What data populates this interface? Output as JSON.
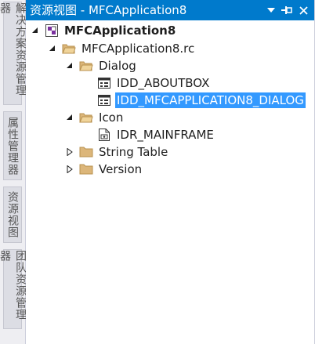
{
  "side_tabs": [
    {
      "label": "解决方案资源管理器"
    },
    {
      "label": "属性管理器"
    },
    {
      "label": "资源视图"
    },
    {
      "label": "团队资源管理器"
    }
  ],
  "title_bar": {
    "title": "资源视图 - MFCApplication8",
    "dropdown_glyph": "▾",
    "pin_glyph": "⊣",
    "close_glyph": "✕",
    "accent_color": "#007acc"
  },
  "tree": {
    "project": {
      "label": "MFCApplication8",
      "icon": "project-icon",
      "expanded": true
    },
    "rc_file": {
      "label": "MFCApplication8.rc",
      "icon": "folder-open-icon",
      "expanded": true
    },
    "dialog_folder": {
      "label": "Dialog",
      "icon": "folder-open-icon",
      "expanded": true
    },
    "dialog_items": [
      {
        "label": "IDD_ABOUTBOX",
        "icon": "dialog-icon",
        "selected": false
      },
      {
        "label": "IDD_MFCAPPLICATION8_DIALOG",
        "icon": "dialog-icon",
        "selected": true
      }
    ],
    "icon_folder": {
      "label": "Icon",
      "icon": "folder-open-icon",
      "expanded": true
    },
    "icon_items": [
      {
        "label": "IDR_MAINFRAME",
        "icon": "icon-resource-icon"
      }
    ],
    "string_table": {
      "label": "String Table",
      "icon": "folder-closed-icon",
      "expanded": false
    },
    "version": {
      "label": "Version",
      "icon": "folder-closed-icon",
      "expanded": false
    },
    "selection_color": "#3399ff"
  }
}
